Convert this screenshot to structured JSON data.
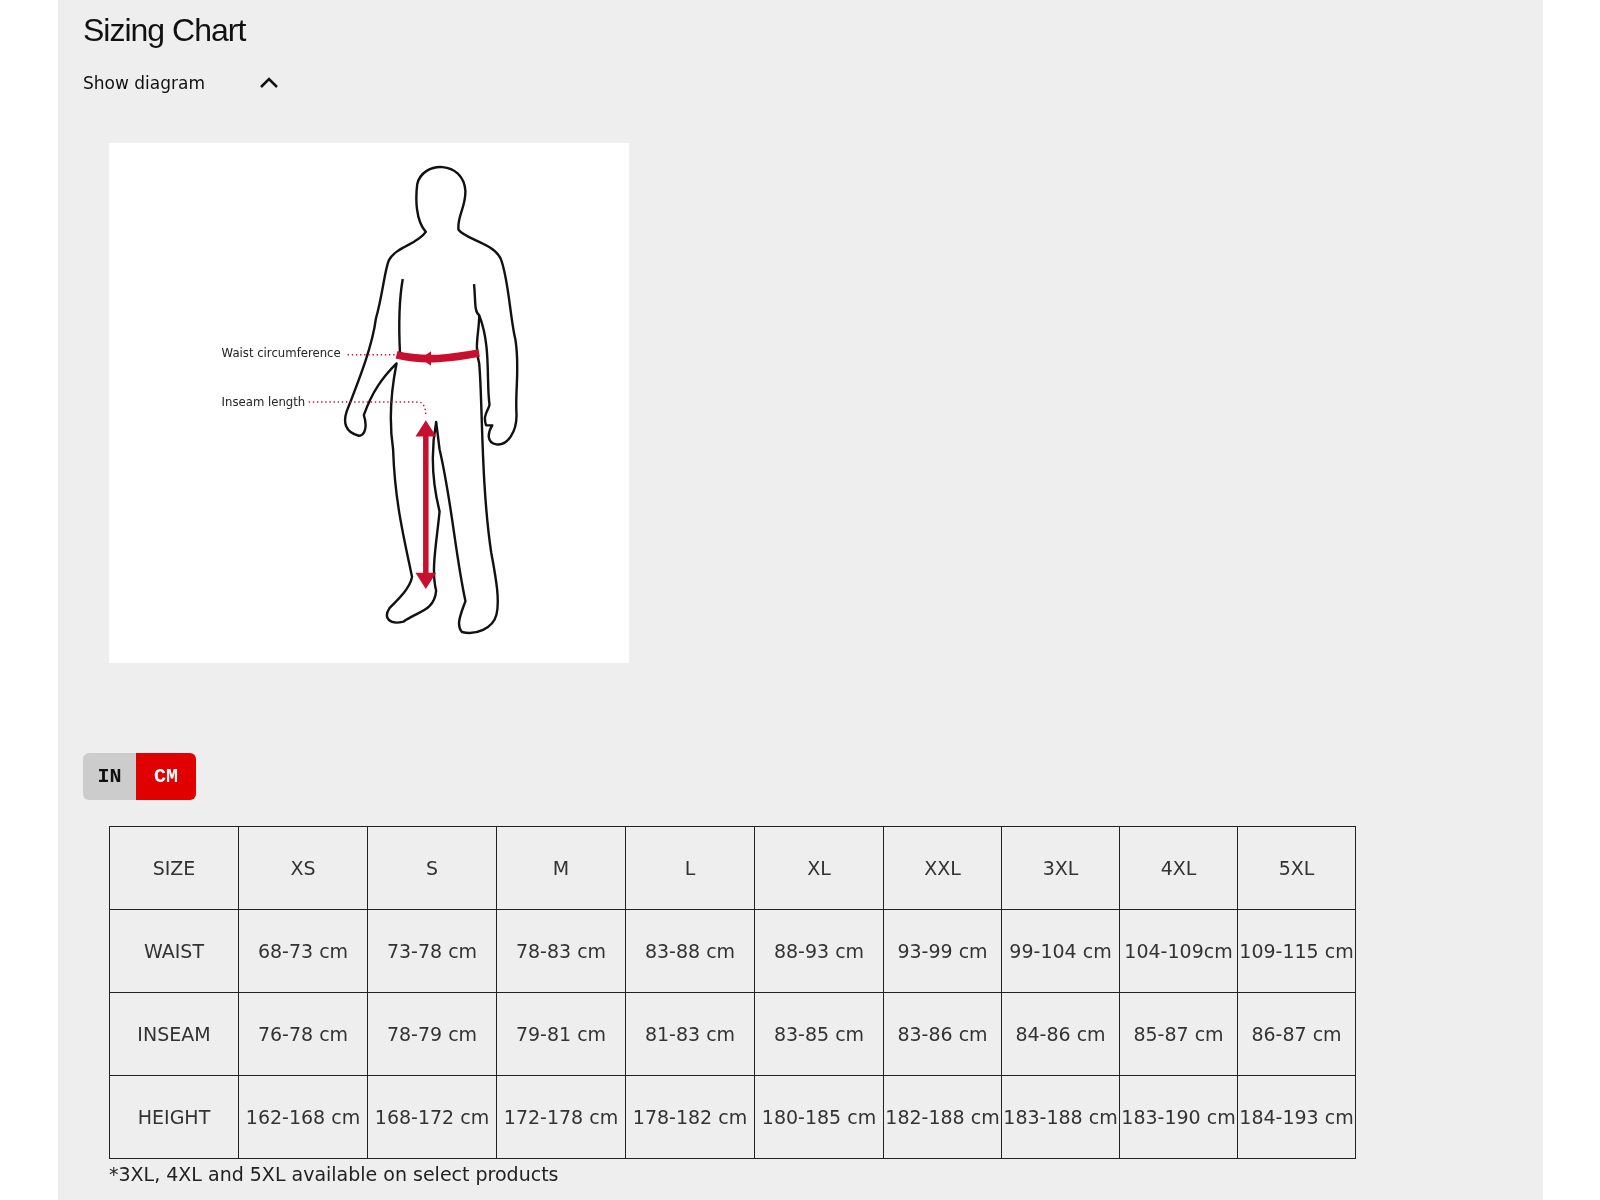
{
  "title": "Sizing Chart",
  "diagram_toggle": {
    "label": "Show diagram",
    "expanded": true
  },
  "diagram": {
    "waist_label": "Waist circumference",
    "inseam_label": "Inseam length"
  },
  "unit_toggle": [
    {
      "label": "IN",
      "selected": false
    },
    {
      "label": "CM",
      "selected": true
    }
  ],
  "table": {
    "columns": [
      "SIZE",
      "XS",
      "S",
      "M",
      "L",
      "XL",
      "XXL",
      "3XL",
      "4XL",
      "5XL"
    ],
    "rows": [
      {
        "cells": [
          "WAIST",
          "68-73 cm",
          "73-78 cm",
          "78-83 cm",
          "83-88 cm",
          "88-93 cm",
          "93-99 cm",
          "99-104 cm",
          "104-109cm",
          "109-115 cm"
        ]
      },
      {
        "cells": [
          "INSEAM",
          "76-78 cm",
          "78-79 cm",
          "79-81 cm",
          "81-83 cm",
          "83-85 cm",
          "83-86 cm",
          "84-86 cm",
          "85-87 cm",
          "86-87 cm"
        ]
      },
      {
        "cells": [
          "HEIGHT",
          "162-168 cm",
          "168-172 cm",
          "172-178 cm",
          "178-182 cm",
          "180-185 cm",
          "182-188 cm",
          "183-188 cm",
          "183-190 cm",
          "184-193 cm"
        ]
      }
    ]
  },
  "footnote": "*3XL, 4XL and 5XL available on select products"
}
